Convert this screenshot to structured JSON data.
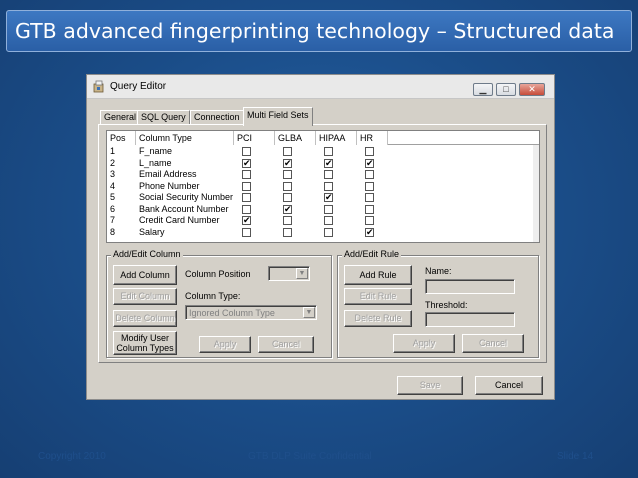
{
  "slide": {
    "title": "GTB advanced fingerprinting technology – Structured data",
    "footer_left": "Copyright 2010",
    "footer_center": "GTB DLP Suite Confidential",
    "footer_right": "Slide 14"
  },
  "window": {
    "title": "Query Editor",
    "minimize_label": "▁",
    "maximize_label": "□",
    "close_label": "✕",
    "tabs": [
      "General",
      "SQL Query",
      "Connection",
      "Multi Field Sets"
    ],
    "active_tab": "Multi Field Sets"
  },
  "grid": {
    "columns": [
      "Pos",
      "Column Type",
      "PCI",
      "GLBA",
      "HIPAA",
      "HR"
    ],
    "rows": [
      {
        "pos": "1",
        "type": "F_name",
        "checks": [
          false,
          false,
          false,
          false
        ]
      },
      {
        "pos": "2",
        "type": "L_name",
        "checks": [
          true,
          true,
          true,
          true
        ]
      },
      {
        "pos": "3",
        "type": "Email Address",
        "checks": [
          false,
          false,
          false,
          false
        ]
      },
      {
        "pos": "4",
        "type": "Phone Number",
        "checks": [
          false,
          false,
          false,
          false
        ]
      },
      {
        "pos": "5",
        "type": "Social Security Number",
        "checks": [
          false,
          false,
          true,
          false
        ]
      },
      {
        "pos": "6",
        "type": "Bank Account Number",
        "checks": [
          false,
          true,
          false,
          false
        ]
      },
      {
        "pos": "7",
        "type": "Credit Card Number",
        "checks": [
          true,
          false,
          false,
          false
        ]
      },
      {
        "pos": "8",
        "type": "Salary",
        "checks": [
          false,
          false,
          false,
          true
        ]
      }
    ]
  },
  "column_group": {
    "title": "Add/Edit Column",
    "add": "Add Column",
    "edit": "Edit Column",
    "delete": "Delete Column",
    "modify_line1": "Modify User",
    "modify_line2": "Column Types",
    "position_label": "Column Position",
    "type_label": "Column Type:",
    "type_value": "Ignored Column Type",
    "apply": "Apply",
    "cancel": "Cancel"
  },
  "rule_group": {
    "title": "Add/Edit Rule",
    "add": "Add Rule",
    "edit": "Edit Rule",
    "delete": "Delete Rule",
    "name_label": "Name:",
    "threshold_label": "Threshold:",
    "apply": "Apply",
    "cancel": "Cancel"
  },
  "bottom": {
    "save": "Save",
    "cancel": "Cancel"
  }
}
